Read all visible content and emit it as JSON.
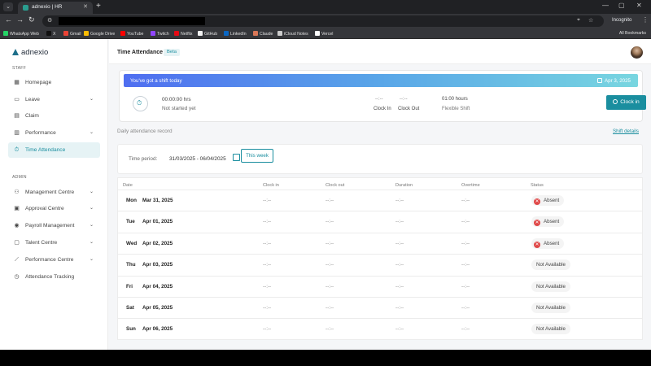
{
  "browser": {
    "tab_title": "adnexio | HR",
    "incognito_label": "Incognito",
    "all_bookmarks": "All Bookmarks",
    "bookmarks": [
      {
        "label": "WhatsApp Web",
        "color": "#25d366"
      },
      {
        "label": "X",
        "color": "#111111"
      },
      {
        "label": "Gmail",
        "color": "#ea4335"
      },
      {
        "label": "Google Drive",
        "color": "#fbbc04"
      },
      {
        "label": "YouTube",
        "color": "#ff0000"
      },
      {
        "label": "Twitch",
        "color": "#9146ff"
      },
      {
        "label": "Netflix",
        "color": "#e50914"
      },
      {
        "label": "GitHub",
        "color": "#f0f0f0"
      },
      {
        "label": "LinkedIn",
        "color": "#0a66c2"
      },
      {
        "label": "Claude",
        "color": "#d97757"
      },
      {
        "label": "iCloud Notes",
        "color": "#cccccc"
      },
      {
        "label": "Vercel",
        "color": "#ffffff"
      }
    ]
  },
  "sidebar": {
    "logo": "adnexio",
    "staff_label": "STAFF",
    "admin_label": "ADMIN",
    "staff_items": [
      {
        "label": "Homepage",
        "icon": "grid-icon"
      },
      {
        "label": "Leave",
        "icon": "calendar-icon",
        "expandable": true
      },
      {
        "label": "Claim",
        "icon": "receipt-icon"
      },
      {
        "label": "Performance",
        "icon": "chart-icon",
        "expandable": true
      },
      {
        "label": "Time Attendance",
        "icon": "stopwatch-icon",
        "active": true
      }
    ],
    "admin_items": [
      {
        "label": "Management Centre",
        "icon": "users-icon",
        "expandable": true
      },
      {
        "label": "Approval Centre",
        "icon": "approval-icon",
        "expandable": true
      },
      {
        "label": "Payroll Management",
        "icon": "payroll-icon",
        "expandable": true
      },
      {
        "label": "Talent Centre",
        "icon": "talent-icon",
        "expandable": true
      },
      {
        "label": "Performance Centre",
        "icon": "trend-icon",
        "expandable": true
      },
      {
        "label": "Attendance Tracking",
        "icon": "clock-icon"
      }
    ]
  },
  "header": {
    "title": "Time Attendance",
    "badge": "Beta"
  },
  "shift_card": {
    "banner_text": "You've got a shift today",
    "banner_date": "Apr 3, 2025",
    "hours": "00:00:00 hrs",
    "status": "Not started yet",
    "clock_in_time": "--:--",
    "clock_in_label": "Clock In",
    "clock_out_time": "--:--",
    "clock_out_label": "Clock Out",
    "shift_hours": "01:00 hours",
    "shift_type": "Flexible Shift",
    "clock_in_button": "Clock in"
  },
  "records": {
    "section_title": "Daily attendance record",
    "shift_details_link": "Shift details",
    "period_label": "Time period:",
    "period_value": "31/03/2025 - 06/04/2025",
    "this_week_button": "This week",
    "columns": [
      "Date",
      "Clock in",
      "Clock out",
      "Duration",
      "Overtime",
      "Status"
    ],
    "rows": [
      {
        "dow": "Mon",
        "date": "Mar 31, 2025",
        "clock_in": "--:--",
        "clock_out": "--:--",
        "duration": "--:--",
        "overtime": "--:--",
        "status": "Absent",
        "absent": true
      },
      {
        "dow": "Tue",
        "date": "Apr 01, 2025",
        "clock_in": "--:--",
        "clock_out": "--:--",
        "duration": "--:--",
        "overtime": "--:--",
        "status": "Absent",
        "absent": true
      },
      {
        "dow": "Wed",
        "date": "Apr 02, 2025",
        "clock_in": "--:--",
        "clock_out": "--:--",
        "duration": "--:--",
        "overtime": "--:--",
        "status": "Absent",
        "absent": true
      },
      {
        "dow": "Thu",
        "date": "Apr 03, 2025",
        "clock_in": "--:--",
        "clock_out": "--:--",
        "duration": "--:--",
        "overtime": "--:--",
        "status": "Not Available",
        "absent": false
      },
      {
        "dow": "Fri",
        "date": "Apr 04, 2025",
        "clock_in": "--:--",
        "clock_out": "--:--",
        "duration": "--:--",
        "overtime": "--:--",
        "status": "Not Available",
        "absent": false
      },
      {
        "dow": "Sat",
        "date": "Apr 05, 2025",
        "clock_in": "--:--",
        "clock_out": "--:--",
        "duration": "--:--",
        "overtime": "--:--",
        "status": "Not Available",
        "absent": false
      },
      {
        "dow": "Sun",
        "date": "Apr 06, 2025",
        "clock_in": "--:--",
        "clock_out": "--:--",
        "duration": "--:--",
        "overtime": "--:--",
        "status": "Not Available",
        "absent": false
      }
    ]
  },
  "colors": {
    "accent": "#1a8e9f",
    "absent": "#e04848",
    "banner_start": "#4f6ef0",
    "banner_end": "#78d6e0"
  }
}
